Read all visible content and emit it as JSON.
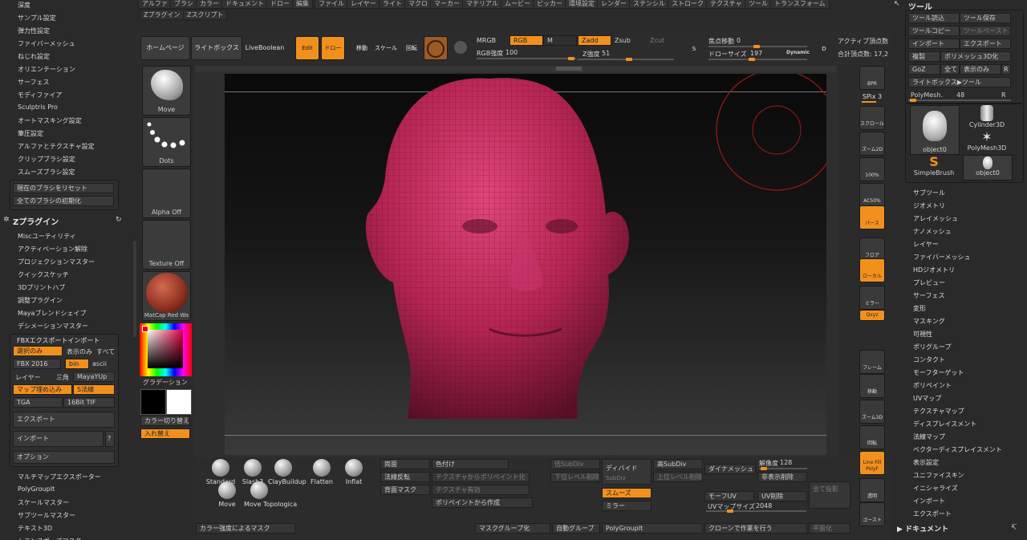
{
  "left_top_items": [
    "深度",
    "サンプル設定",
    "弾力性設定",
    "ファイバーメッシュ",
    "ねじれ設定",
    "オリエンテーション",
    "サーフェス",
    "モディファイア",
    "Sculptris Pro",
    "オートマスキング設定",
    "筆圧設定",
    "アルファとテクスチャ設定",
    "クリップブラシ設定",
    "スムーズブラシ設定"
  ],
  "brush_reset": "現在のブラシをリセット",
  "brush_init": "全てのブラシの初期化",
  "zplugin_title": "Zプラグイン",
  "zplugin_items": [
    "Miscユーティリティ",
    "アクティベーション解除",
    "プロジェクションマスター",
    "クイックスケッチ",
    "3Dプリントハブ",
    "調整プラグイン",
    "Mayaブレンドシェイプ",
    "デシメーションマスター"
  ],
  "fbx": {
    "title": "FBXエクスポートインポート",
    "selected": "選択のみ",
    "visible": "表示のみ",
    "all": "すべて",
    "ver": "FBX 2016",
    "bin": "bin",
    "ascii": "ascii",
    "layer": "レイヤー",
    "tri": "三角",
    "mayayup": "MayaYUp",
    "mapembed": "マップ埋め込み",
    "snormal": "S法線",
    "tga": "TGA",
    "tif": "16Bit TIF",
    "export": "エクスポート",
    "import": "インポート",
    "q": "?",
    "options": "オプション"
  },
  "left_bottom_items": [
    "マルチマップエクスポーター",
    "PolyGroupIt",
    "スケールマスター",
    "サブツールマスター",
    "テキスト3D",
    "トランスポーズマスター"
  ],
  "menu": [
    "アルファ",
    "ブラシ",
    "カラー",
    "ドキュメント",
    "ドロー",
    "編集",
    "ファイル",
    "レイヤー",
    "ライト",
    "マクロ",
    "マーカー",
    "マテリアル",
    "ムービー",
    "ピッカー",
    "環境設定",
    "レンダー",
    "ステンシル",
    "ストローク",
    "テクスチャ",
    "ツール",
    "トランスフォーム"
  ],
  "menu2": [
    "Zプラグイン",
    "Zスクリプト"
  ],
  "toolbar": {
    "home": "ホームページ",
    "lightbox": "ライトボックス",
    "liveboolean": "LiveBoolean",
    "edit": "Edit",
    "draw": "ドロー",
    "move": "移動",
    "scale": "スケール",
    "rotate": "回転",
    "mrgb": "MRGB",
    "rgb": "RGB",
    "m": "M",
    "rgb_int_label": "RGB強度",
    "rgb_int": "100",
    "zadd": "Zadd",
    "zsub": "Zsub",
    "zcut": "Zcut",
    "z_int_label": "Z強度",
    "z_int": "51",
    "focal_label": "焦点移動",
    "focal": "0",
    "drawsize_label": "ドローサイズ",
    "drawsize": "197",
    "dynamic": "Dynamic",
    "s": "S",
    "d": "D",
    "active_pts": "アクティブ頂点数",
    "total_pts": "合計頂点数: 17,2"
  },
  "brush_column": {
    "move": "Move",
    "dots": "Dots",
    "alpha": "Alpha Off",
    "texture": "Texture Off",
    "matcap": "MatCap Red Wa",
    "gradient": "グラデーション",
    "swap": "カラー切り替え",
    "invert": "入れ替え"
  },
  "right_shelf": [
    {
      "name": "bpr",
      "label": "BPR"
    },
    {
      "name": "spix",
      "label": "SPix 3"
    },
    {
      "name": "scroll",
      "label": "スクロール"
    },
    {
      "name": "zoom2d",
      "label": "ズーム2D"
    },
    {
      "name": "100",
      "label": "100%"
    },
    {
      "name": "ac50",
      "label": "AC50%"
    },
    {
      "name": "dynamic-persp",
      "label": "パース"
    },
    {
      "name": "floor",
      "label": "フロア"
    },
    {
      "name": "local",
      "label": "ローカル"
    },
    {
      "name": "symmetry",
      "label": "ミラー"
    },
    {
      "name": "xyz",
      "label": "Qxyz"
    },
    {
      "name": "frame",
      "label": "フレーム"
    },
    {
      "name": "move",
      "label": "移動"
    },
    {
      "name": "zoom3d",
      "label": "ズーム3D"
    },
    {
      "name": "rotate",
      "label": "回転"
    },
    {
      "name": "polyf",
      "label": "Line Fill PolyF"
    },
    {
      "name": "transp",
      "label": "透明"
    },
    {
      "name": "ghost",
      "label": "ゴースト"
    }
  ],
  "tool": {
    "title": "ツール",
    "load": "ツール読込",
    "save": "ツール保存",
    "copy": "ツールコピー",
    "paste": "ツールペースト",
    "import": "インポート",
    "export": "エクスポート",
    "clone": "複製",
    "polymesh": "ポリメッシュ3D化",
    "goz": "GoZ",
    "all": "全て",
    "visible": "表示のみ",
    "r": "R",
    "lightbox": "ライトボックス▶ツール",
    "polymesh_label": "PolyMesh.",
    "polymesh_val": "48",
    "thumbs": [
      "object0",
      "Cylinder3D",
      "PolyMesh3D",
      "SimpleBrush",
      "object0"
    ],
    "items": [
      "サブツール",
      "ジオメトリ",
      "アレイメッシュ",
      "ナノメッシュ",
      "レイヤー",
      "ファイバーメッシュ",
      "HDジオメトリ",
      "プレビュー",
      "サーフェス",
      "変形",
      "マスキング",
      "可視性",
      "ポリグループ",
      "コンタクト",
      "モーフターゲット",
      "ポリペイント",
      "UVマップ",
      "テクスチャマップ",
      "ディスプレイスメント",
      "法線マップ",
      "ベクターディスプレイスメント",
      "表示設定",
      "ユニファイスキン",
      "イニシャライズ",
      "インポート",
      "エクスポート"
    ],
    "document": "ドキュメント"
  },
  "bottom": {
    "brushes": [
      "Standard",
      "Slash3",
      "ClayBuildup",
      "Flatten",
      "Inflat",
      "Move",
      "Move Topologica"
    ],
    "double": "両面",
    "flip": "法線反転",
    "backmask": "背面マスク",
    "colorize": "色付け",
    "tex_to_pp": "テクスチャからポリペイント化",
    "tex_on": "テクスチャ有効",
    "pp_create": "ポリペイントから作成",
    "lowsub": "低SubDiv",
    "lowdel": "下位レベル削除",
    "divide": "ディバイド",
    "subdiv": "SubDiv",
    "highsub": "高SubDiv",
    "highdel": "上位レベル削除",
    "smooth": "スムーズ",
    "mirror": "ミラー",
    "dynamesh": "ダイナメッシュ",
    "res_label": "解像度",
    "res": "128",
    "hide_del": "非表示削除",
    "morphuv": "モーフUV",
    "uvdel": "UV削除",
    "uvsize_label": "UVマップサイズ",
    "uvsize": "2048",
    "projall": "全て投影",
    "maskint": "カラー強度によるマスク",
    "maskgroup": "マスクグループ化",
    "autogroup": "自動グループ",
    "polygroupit": "PolyGroupIt",
    "clonework": "クローンで作業を行う",
    "flatten": "平面化"
  }
}
